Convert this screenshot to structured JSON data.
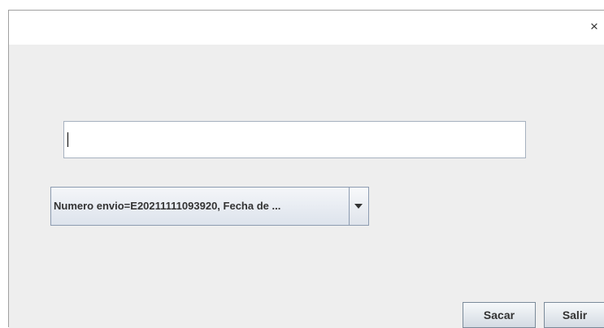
{
  "window": {
    "close_glyph": "×"
  },
  "form": {
    "text_input_value": "",
    "combo_selected": "Numero envio=E20211111093920, Fecha de ..."
  },
  "buttons": {
    "sacar_label": "Sacar",
    "salir_label": "Salir"
  },
  "icons": {
    "close": "close-icon",
    "dropdown": "chevron-down-icon"
  },
  "colors": {
    "window_bg": "#ffffff",
    "content_bg": "#eeeeee",
    "input_border": "#a6b1bf",
    "button_border": "#7a8a99"
  }
}
